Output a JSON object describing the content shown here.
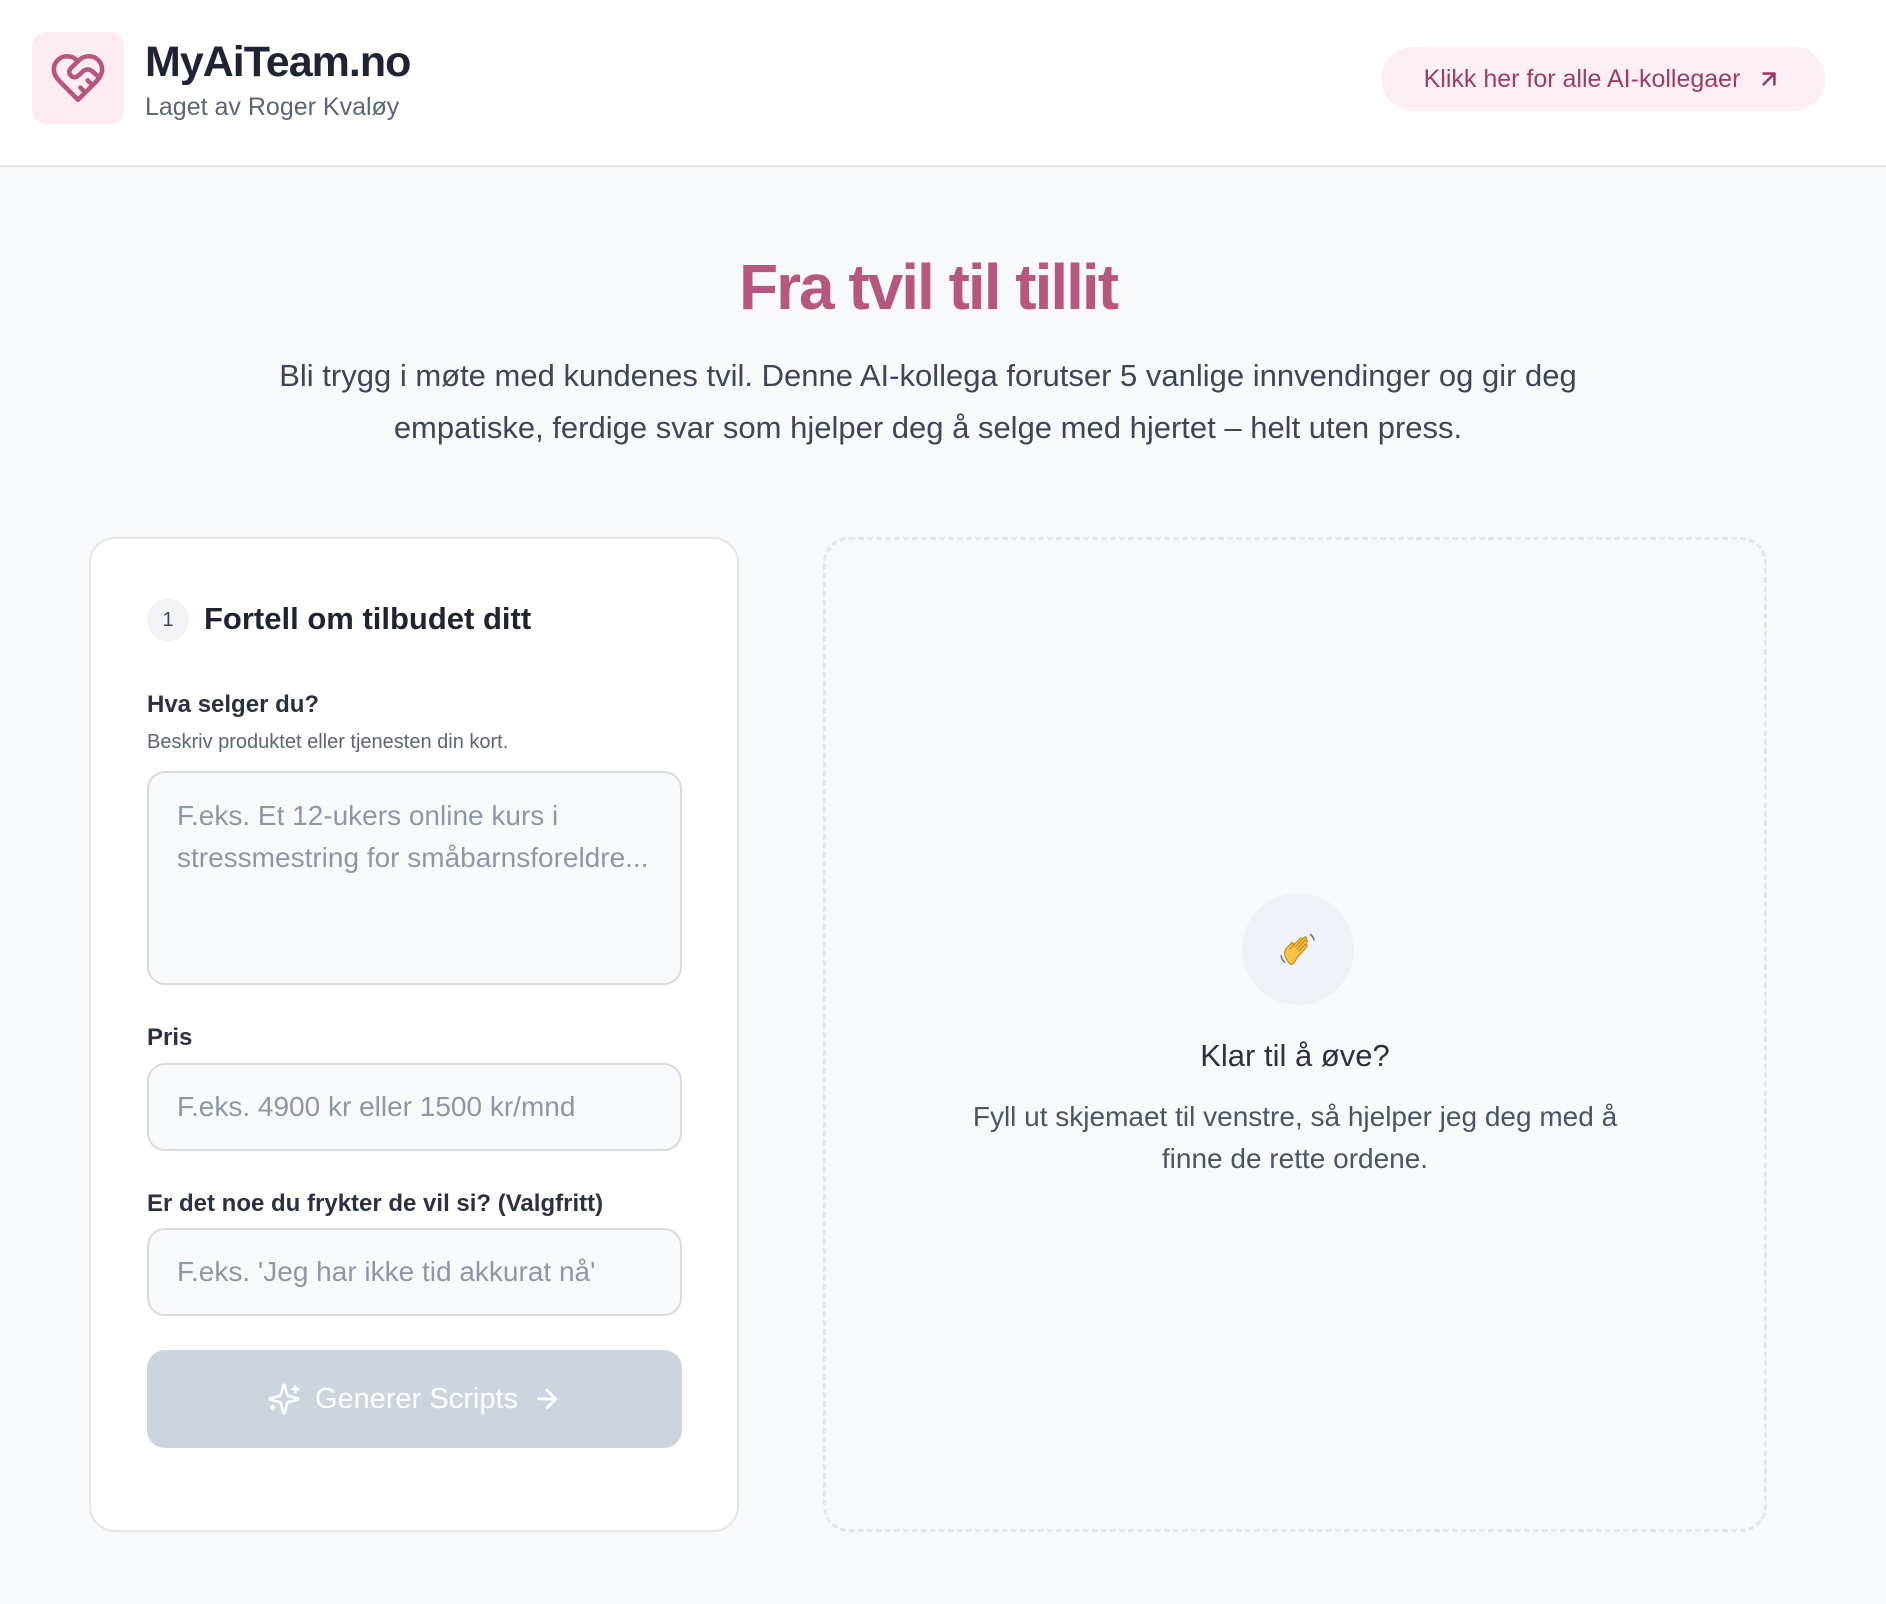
{
  "header": {
    "brand_title": "MyAiTeam.no",
    "brand_subtitle": "Laget av Roger Kvaløy",
    "link_label": "Klikk her for alle AI-kollegaer",
    "logo_icon": "heart-handshake-icon",
    "link_icon": "arrow-up-right-icon"
  },
  "hero": {
    "title": "Fra tvil til tillit",
    "description": "Bli trygg i møte med kundenes tvil. Denne AI-kollega forutser 5 vanlige innvendinger og gir deg empatiske, ferdige svar som hjelper deg å selge med hjertet – helt uten press."
  },
  "form": {
    "step_number": "1",
    "title": "Fortell om tilbudet ditt",
    "product": {
      "label": "Hva selger du?",
      "hint": "Beskriv produktet eller tjenesten din kort.",
      "value": "",
      "placeholder": "F.eks. Et 12-ukers online kurs i stressmestring for småbarnsforeldre..."
    },
    "price": {
      "label": "Pris",
      "value": "",
      "placeholder": "F.eks. 4900 kr eller 1500 kr/mnd"
    },
    "fear": {
      "label": "Er det noe du frykter de vil si? (Valgfritt)",
      "value": "",
      "placeholder": "F.eks. 'Jeg har ikke tid akkurat nå'"
    },
    "submit": {
      "label": "Generer Scripts",
      "icon_left": "sparkles-icon",
      "icon_right": "arrow-right-icon",
      "disabled": true
    }
  },
  "preview": {
    "icon": "👋",
    "title": "Klar til å øve?",
    "description": "Fyll ut skjemaet til venstre, så hjelper jeg deg med å finne de rette ordene."
  },
  "colors": {
    "accent": "#b5577f",
    "accent_dark": "#9b3d68",
    "accent_soft": "#fbeff4",
    "button_disabled": "#cdd4de",
    "background": "#f8f9fb"
  }
}
